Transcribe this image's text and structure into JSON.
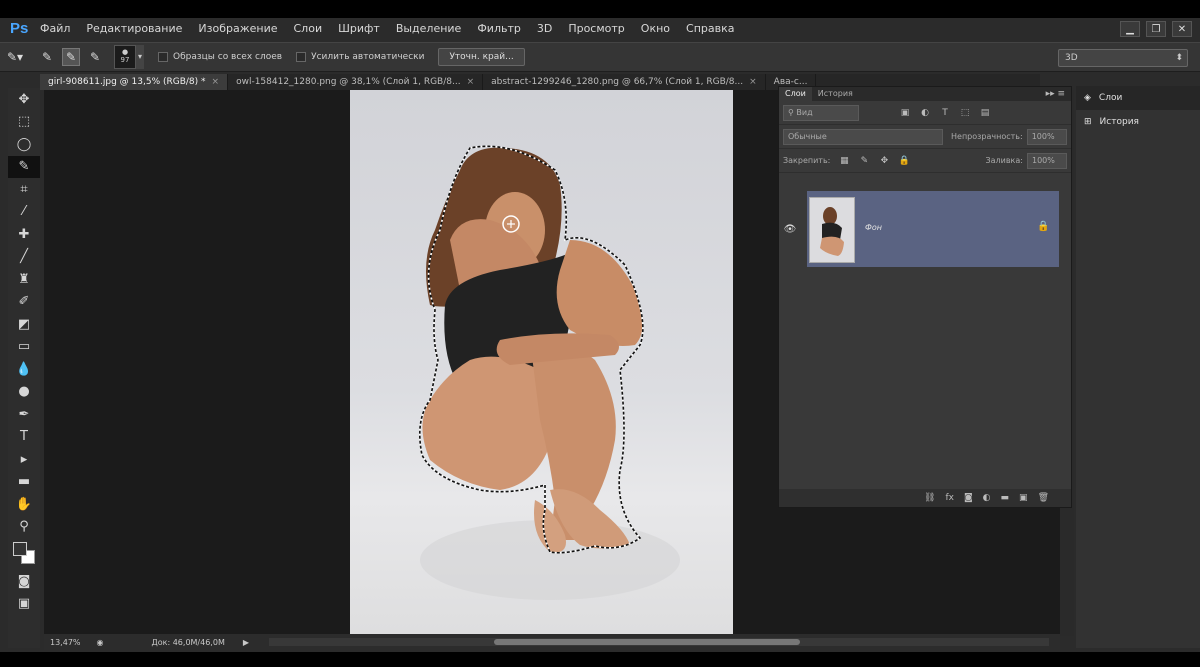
{
  "app": {
    "logo": "Ps"
  },
  "menu": [
    "Файл",
    "Редактирование",
    "Изображение",
    "Слои",
    "Шрифт",
    "Выделение",
    "Фильтр",
    "3D",
    "Просмотр",
    "Окно",
    "Справка"
  ],
  "window_controls": [
    "minimize",
    "restore",
    "close"
  ],
  "options": {
    "brush_size": "97",
    "sample_all_layers": "Образцы со всех слоев",
    "auto_enhance": "Усилить автоматически",
    "refine_edge": "Уточн. край...",
    "workspace": "3D"
  },
  "tabs": [
    {
      "label": "girl-908611.jpg @ 13,5% (RGB/8) *",
      "active": true
    },
    {
      "label": "owl-158412_1280.png @ 38,1% (Слой 1, RGB/8...",
      "active": false
    },
    {
      "label": "abstract-1299246_1280.png @ 66,7% (Слой 1, RGB/8...",
      "active": false
    },
    {
      "label": "Ава-с...",
      "active": false
    }
  ],
  "status": {
    "zoom": "13,47%",
    "doc": "Док: 46,0M/46,0M"
  },
  "layers_panel": {
    "tabs": [
      "Слои",
      "История"
    ],
    "filter_label": "Вид",
    "blend_mode": "Обычные",
    "opacity_label": "Непрозрачность:",
    "opacity_value": "100%",
    "lock_label": "Закрепить:",
    "fill_label": "Заливка:",
    "fill_value": "100%",
    "layer_name": "Фон"
  },
  "dock": [
    {
      "label": "Слои",
      "icon": "layers-icon"
    },
    {
      "label": "История",
      "icon": "history-icon"
    }
  ],
  "colors": {
    "accent": "#49a6ff",
    "selection": "#5a6382",
    "background": "#2b2b2b"
  }
}
